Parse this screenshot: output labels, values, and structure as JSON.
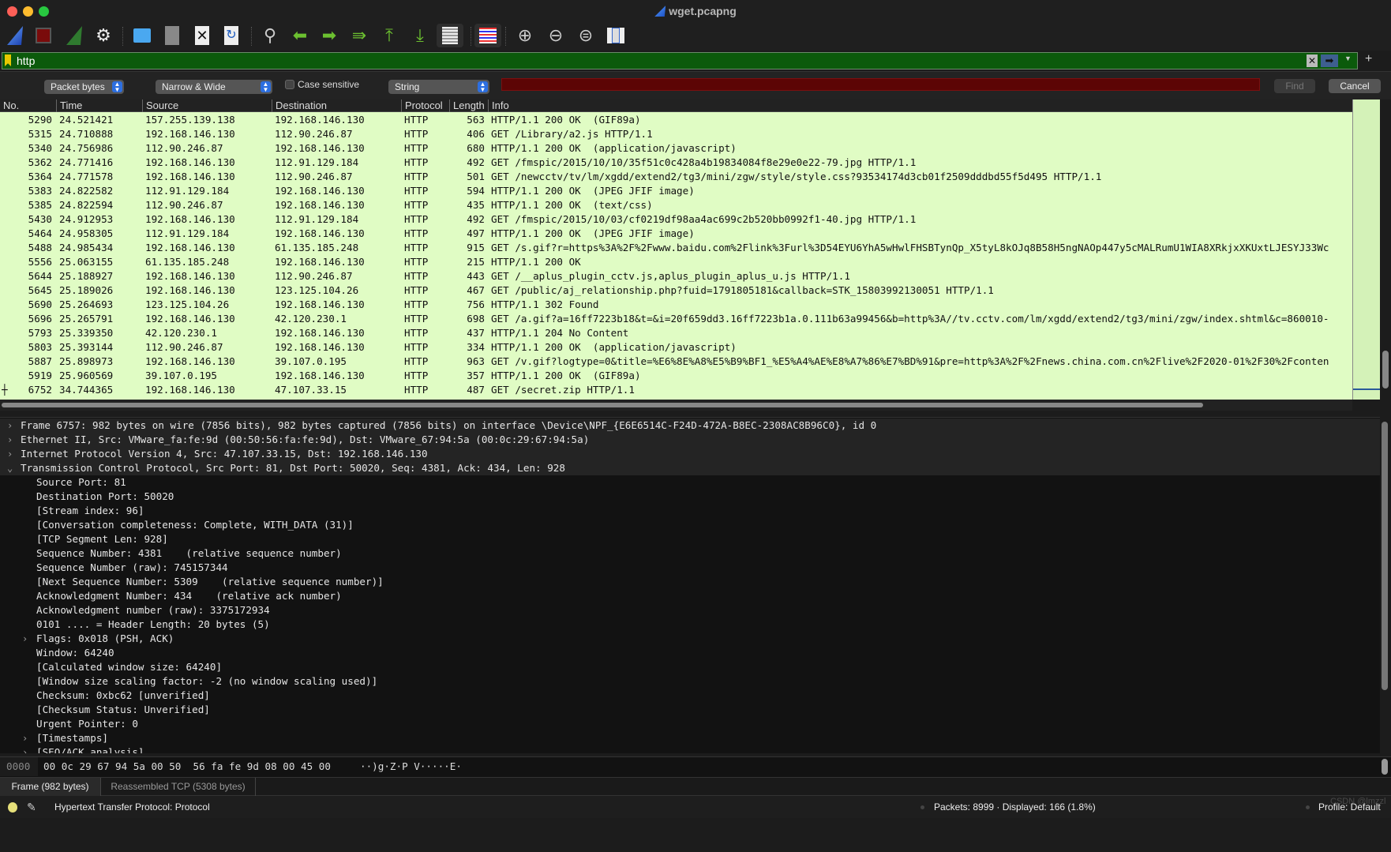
{
  "window": {
    "title": "wget.pcapng"
  },
  "toolbar": {
    "icons": [
      "shark-fin-start-icon",
      "stop-capture-icon",
      "restart-capture-icon",
      "capture-options-icon",
      "open-file-icon",
      "save-file-icon",
      "close-file-icon",
      "reload-file-icon",
      "find-packet-icon",
      "go-back-icon",
      "go-forward-icon",
      "go-to-packet-icon",
      "first-packet-icon",
      "last-packet-icon",
      "autoscroll-icon",
      "colorize-icon",
      "zoom-in-icon",
      "zoom-out-icon",
      "normal-size-icon",
      "resize-columns-icon"
    ]
  },
  "filter": {
    "value": "http",
    "bg_color": "#0b5a0b"
  },
  "findbar": {
    "search_in": "Packet bytes",
    "char_width": "Narrow & Wide",
    "case_sensitive_label": "Case sensitive",
    "case_sensitive": false,
    "search_type": "String",
    "find_label": "Find",
    "cancel_label": "Cancel"
  },
  "packet_list": {
    "columns": [
      "No.",
      "Time",
      "Source",
      "Destination",
      "Protocol",
      "Length",
      "Info"
    ],
    "row_color": "#e0fcc4",
    "rows": [
      [
        "5290",
        "24.521421",
        "157.255.139.138",
        "192.168.146.130",
        "HTTP",
        "563",
        "HTTP/1.1 200 OK  (GIF89a)"
      ],
      [
        "5315",
        "24.710888",
        "192.168.146.130",
        "112.90.246.87",
        "HTTP",
        "406",
        "GET /Library/a2.js HTTP/1.1"
      ],
      [
        "5340",
        "24.756986",
        "112.90.246.87",
        "192.168.146.130",
        "HTTP",
        "680",
        "HTTP/1.1 200 OK  (application/javascript)"
      ],
      [
        "5362",
        "24.771416",
        "192.168.146.130",
        "112.91.129.184",
        "HTTP",
        "492",
        "GET /fmspic/2015/10/10/35f51c0c428a4b19834084f8e29e0e22-79.jpg HTTP/1.1"
      ],
      [
        "5364",
        "24.771578",
        "192.168.146.130",
        "112.90.246.87",
        "HTTP",
        "501",
        "GET /newcctv/tv/lm/xgdd/extend2/tg3/mini/zgw/style/style.css?93534174d3cb01f2509dddbd55f5d495 HTTP/1.1"
      ],
      [
        "5383",
        "24.822582",
        "112.91.129.184",
        "192.168.146.130",
        "HTTP",
        "594",
        "HTTP/1.1 200 OK  (JPEG JFIF image)"
      ],
      [
        "5385",
        "24.822594",
        "112.90.246.87",
        "192.168.146.130",
        "HTTP",
        "435",
        "HTTP/1.1 200 OK  (text/css)"
      ],
      [
        "5430",
        "24.912953",
        "192.168.146.130",
        "112.91.129.184",
        "HTTP",
        "492",
        "GET /fmspic/2015/10/03/cf0219df98aa4ac699c2b520bb0992f1-40.jpg HTTP/1.1"
      ],
      [
        "5464",
        "24.958305",
        "112.91.129.184",
        "192.168.146.130",
        "HTTP",
        "497",
        "HTTP/1.1 200 OK  (JPEG JFIF image)"
      ],
      [
        "5488",
        "24.985434",
        "192.168.146.130",
        "61.135.185.248",
        "HTTP",
        "915",
        "GET /s.gif?r=https%3A%2F%2Fwww.baidu.com%2Flink%3Furl%3D54EYU6YhA5wHwlFHSBTynQp_X5tyL8kOJq8B58H5ngNAOp447y5cMALRumU1WIA8XRkjxXKUxtLJESYJ33Wc"
      ],
      [
        "5556",
        "25.063155",
        "61.135.185.248",
        "192.168.146.130",
        "HTTP",
        "215",
        "HTTP/1.1 200 OK"
      ],
      [
        "5644",
        "25.188927",
        "192.168.146.130",
        "112.90.246.87",
        "HTTP",
        "443",
        "GET /__aplus_plugin_cctv.js,aplus_plugin_aplus_u.js HTTP/1.1"
      ],
      [
        "5645",
        "25.189026",
        "192.168.146.130",
        "123.125.104.26",
        "HTTP",
        "467",
        "GET /public/aj_relationship.php?fuid=1791805181&callback=STK_15803992130051 HTTP/1.1"
      ],
      [
        "5690",
        "25.264693",
        "123.125.104.26",
        "192.168.146.130",
        "HTTP",
        "756",
        "HTTP/1.1 302 Found"
      ],
      [
        "5696",
        "25.265791",
        "192.168.146.130",
        "42.120.230.1",
        "HTTP",
        "698",
        "GET /a.gif?a=16ff7223b18&t=&i=20f659dd3.16ff7223b1a.0.111b63a99456&b=http%3A//tv.cctv.com/lm/xgdd/extend2/tg3/mini/zgw/index.shtml&c=860010-"
      ],
      [
        "5793",
        "25.339350",
        "42.120.230.1",
        "192.168.146.130",
        "HTTP",
        "437",
        "HTTP/1.1 204 No Content"
      ],
      [
        "5803",
        "25.393144",
        "112.90.246.87",
        "192.168.146.130",
        "HTTP",
        "334",
        "HTTP/1.1 200 OK  (application/javascript)"
      ],
      [
        "5887",
        "25.898973",
        "192.168.146.130",
        "39.107.0.195",
        "HTTP",
        "963",
        "GET /v.gif?logtype=0&title=%E6%8E%A8%E5%B9%BF1_%E5%A4%AE%E8%A7%86%E7%BD%91&pre=http%3A%2F%2Fnews.china.com.cn%2Flive%2F2020-01%2F30%2Fconten"
      ],
      [
        "5919",
        "25.960569",
        "39.107.0.195",
        "192.168.146.130",
        "HTTP",
        "357",
        "HTTP/1.1 200 OK  (GIF89a)"
      ],
      [
        "6752",
        "34.744365",
        "192.168.146.130",
        "47.107.33.15",
        "HTTP",
        "487",
        "GET /secret.zip HTTP/1.1"
      ]
    ]
  },
  "details": [
    {
      "text": "Frame 6757: 982 bytes on wire (7856 bits), 982 bytes captured (7856 bits) on interface \\Device\\NPF_{E6E6514C-F24D-472A-B8EC-2308AC8B96C0}, id 0",
      "level": 0,
      "expander": "collapsed"
    },
    {
      "text": "Ethernet II, Src: VMware_fa:fe:9d (00:50:56:fa:fe:9d), Dst: VMware_67:94:5a (00:0c:29:67:94:5a)",
      "level": 0,
      "expander": "collapsed"
    },
    {
      "text": "Internet Protocol Version 4, Src: 47.107.33.15, Dst: 192.168.146.130",
      "level": 0,
      "expander": "collapsed"
    },
    {
      "text": "Transmission Control Protocol, Src Port: 81, Dst Port: 50020, Seq: 4381, Ack: 434, Len: 928",
      "level": 0,
      "expander": "expanded"
    },
    {
      "text": "Source Port: 81",
      "level": 1,
      "expander": ""
    },
    {
      "text": "Destination Port: 50020",
      "level": 1,
      "expander": ""
    },
    {
      "text": "[Stream index: 96]",
      "level": 1,
      "expander": ""
    },
    {
      "text": "[Conversation completeness: Complete, WITH_DATA (31)]",
      "level": 1,
      "expander": ""
    },
    {
      "text": "[TCP Segment Len: 928]",
      "level": 1,
      "expander": ""
    },
    {
      "text": "Sequence Number: 4381    (relative sequence number)",
      "level": 1,
      "expander": ""
    },
    {
      "text": "Sequence Number (raw): 745157344",
      "level": 1,
      "expander": ""
    },
    {
      "text": "[Next Sequence Number: 5309    (relative sequence number)]",
      "level": 1,
      "expander": ""
    },
    {
      "text": "Acknowledgment Number: 434    (relative ack number)",
      "level": 1,
      "expander": ""
    },
    {
      "text": "Acknowledgment number (raw): 3375172934",
      "level": 1,
      "expander": ""
    },
    {
      "text": "0101 .... = Header Length: 20 bytes (5)",
      "level": 1,
      "expander": ""
    },
    {
      "text": "Flags: 0x018 (PSH, ACK)",
      "level": 1,
      "expander": "collapsed"
    },
    {
      "text": "Window: 64240",
      "level": 1,
      "expander": ""
    },
    {
      "text": "[Calculated window size: 64240]",
      "level": 1,
      "expander": ""
    },
    {
      "text": "[Window size scaling factor: -2 (no window scaling used)]",
      "level": 1,
      "expander": ""
    },
    {
      "text": "Checksum: 0xbc62 [unverified]",
      "level": 1,
      "expander": ""
    },
    {
      "text": "[Checksum Status: Unverified]",
      "level": 1,
      "expander": ""
    },
    {
      "text": "Urgent Pointer: 0",
      "level": 1,
      "expander": ""
    },
    {
      "text": "[Timestamps]",
      "level": 1,
      "expander": "collapsed"
    },
    {
      "text": "[SEQ/ACK analysis]",
      "level": 1,
      "expander": "collapsed"
    }
  ],
  "bytes": {
    "offset": "0000",
    "hex": "00 0c 29 67 94 5a 00 50  56 fa fe 9d 08 00 45 00",
    "ascii": "··)g·Z·P V·····E·"
  },
  "byte_tabs": [
    "Frame (982 bytes)",
    "Reassembled TCP (5308 bytes)"
  ],
  "status": {
    "field": "Hypertext Transfer Protocol: Protocol",
    "packets": "Packets: 8999 · Displayed: 166 (1.8%)",
    "profile": "Profile: Default",
    "watermark": "CSDN @lmzzl"
  }
}
